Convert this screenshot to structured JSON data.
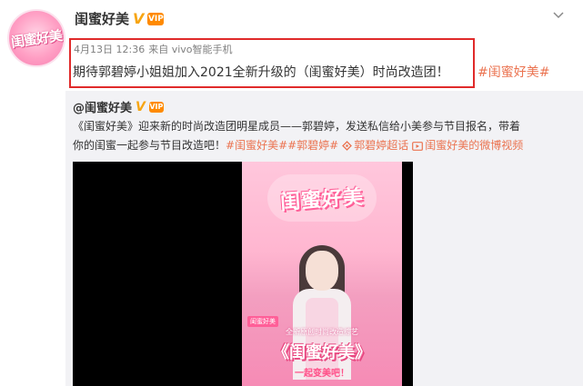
{
  "post": {
    "avatar_text": "闺蜜好美",
    "author": "闺蜜好美",
    "verified_mark": "V",
    "member_mark": "VIP",
    "timestamp": "4月13日 12:36",
    "source": "来自 vivo智能手机",
    "text": "期待郭碧婷小姐姐加入2021全新升级的（闺蜜好美）时尚改造团！",
    "tag": "#闺蜜好美#"
  },
  "repost": {
    "author": "@闺蜜好美",
    "line1": "《闺蜜好美》迎来新的时尚改造团明星成员——郭碧婷，发送私信给小美参与节目报名，带着",
    "line2_text": "你的闺蜜一起参与节目改造吧！",
    "tags": "#闺蜜好美##郭碧婷#",
    "supertopic": "郭碧婷超话",
    "video_link": "闺蜜好美的微博视频"
  },
  "poster": {
    "logo": "闺蜜好美",
    "badge": "闺蜜好美",
    "caption": "全新原创时尚改造综艺",
    "title": "《闺蜜好美》",
    "subtitle": "一起变美吧！"
  },
  "colors": {
    "accent": "#eb7350",
    "highlight_border": "#e02a2a",
    "verified": "#f7a512"
  }
}
